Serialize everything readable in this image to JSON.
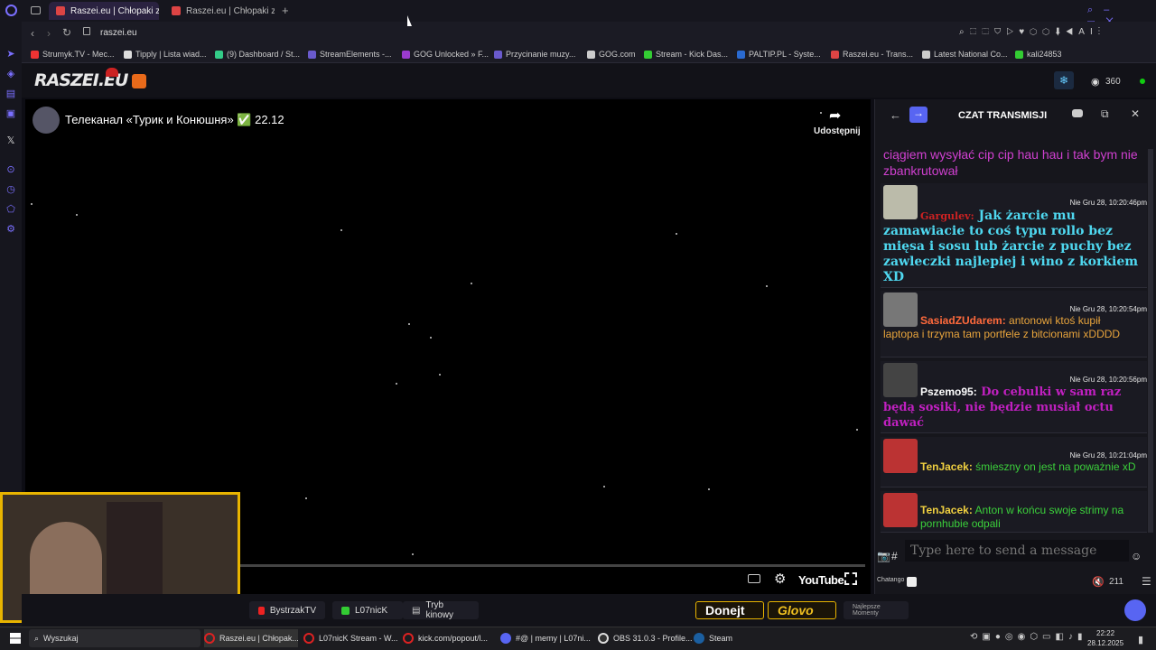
{
  "tabs": [
    {
      "label": "Raszei.eu | Chłopaki z Ra"
    },
    {
      "label": "Raszei.eu | Chłopaki z Ra"
    }
  ],
  "address": "raszei.eu",
  "bookmarks": [
    "Strumyk.TV - Mec...",
    "Tipply | Lista wiad...",
    "(9) Dashboard / St...",
    "StreamElements -...",
    "GOG Unlocked » F...",
    "Przycinanie muzy...",
    "GOG.com",
    "Stream - Kick Das...",
    "PALTIP.PL - Syste...",
    "Raszei.eu - Trans...",
    "Latest National Co...",
    "kali24853"
  ],
  "site": {
    "logo": "RASZEI.EU",
    "viewers": "360"
  },
  "player": {
    "title": "Телеканал «Турик и Конюшня» ✅ 22.12",
    "share": "Udostępnij",
    "youtube": "YouTube"
  },
  "chat": {
    "title": "CZAT TRANSMISJI",
    "top_text": "ciągiem wysyłać cip cip hau hau i tak bym nie zbankrutował",
    "messages": [
      {
        "time": "Nie Gru 28, 10:20:46pm",
        "nick": "Gargulev:",
        "text": "Jak żarcie mu zamawiacie to coś typu rollo bez mięsa i sosu lub żarcie z puchy bez zawleczki najlepiej i wino z korkiem XD"
      },
      {
        "time": "Nie Gru 28, 10:20:54pm",
        "nick": "SasiadZUdarem:",
        "text": "antonowi ktoś kupił laptopa i trzyma tam portfele z bitcionami xDDDD"
      },
      {
        "time": "Nie Gru 28, 10:20:56pm",
        "nick": "Pszemo95:",
        "text": "Do cebulki w sam raz będą sosiki, nie będzie musiał octu dawać"
      },
      {
        "time": "Nie Gru 28, 10:21:04pm",
        "nick": "TenJacek:",
        "text": "śmieszny on jest na poważnie xD"
      },
      {
        "time": "",
        "nick": "TenJacek:",
        "text": "Anton w końcu swoje strimy na pornhubie odpali"
      }
    ],
    "input_placeholder": "Type here to send a message",
    "chatango": "Chatango",
    "user_count": "211"
  },
  "bottom": {
    "bystrzak": "BystrzakTV",
    "lo7nick": "L07nicK",
    "tryb": "Tryb kinowy",
    "donejt": "Donejt",
    "glovo": "Glovo",
    "najlepsze": "Najlepsze Momenty"
  },
  "taskbar": {
    "search": "Wyszukaj",
    "items": [
      "Raszei.eu | Chłopak...",
      "L07nicK Stream - W...",
      "kick.com/popout/l...",
      "#@ | memy | L07ni...",
      "OBS 31.0.3 - Profile...",
      "Steam"
    ],
    "time": "22:22",
    "date": "28.12.2025"
  }
}
